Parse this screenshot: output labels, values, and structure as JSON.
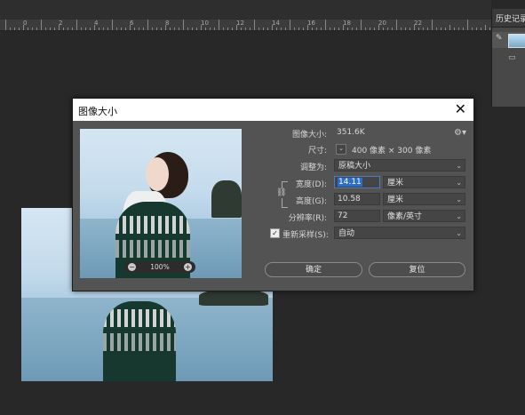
{
  "ruler": {
    "labels": [
      "0",
      "2",
      "4",
      "6",
      "8",
      "10",
      "12",
      "14",
      "16",
      "18",
      "20",
      "22"
    ]
  },
  "history_panel": {
    "tab_label": "历史记录"
  },
  "dialog": {
    "title": "图像大小",
    "zoom": "100%",
    "image_size_label": "图像大小:",
    "image_size_value": "351.6K",
    "dimensions_label": "尺寸:",
    "dimensions_value": "400 像素 × 300 像素",
    "fit_label": "调整为:",
    "fit_value": "原稿大小",
    "width_label": "宽度(D):",
    "width_value": "14.11",
    "width_unit": "厘米",
    "height_label": "高度(G):",
    "height_value": "10.58",
    "height_unit": "厘米",
    "resolution_label": "分辨率(R):",
    "resolution_value": "72",
    "resolution_unit": "像素/英寸",
    "resample_label": "重新采样(S):",
    "resample_value": "自动",
    "resample_checked": true,
    "ok_label": "确定",
    "reset_label": "复位"
  }
}
